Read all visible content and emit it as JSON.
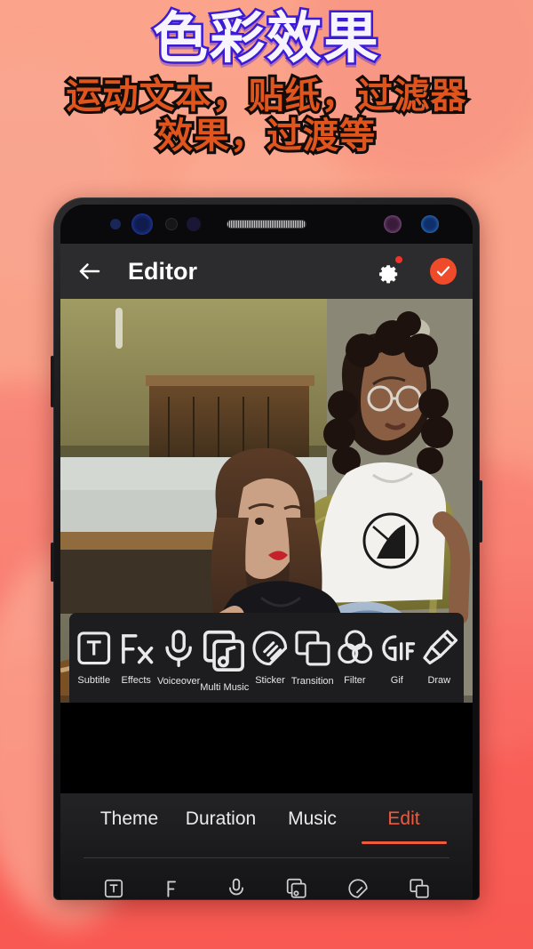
{
  "promo": {
    "title": "色彩效果",
    "subtitle_line1": "运动文本，贴纸，过滤器",
    "subtitle_line2": "效果，过渡等",
    "title_color": "#F7F4FB",
    "title_outline_color": "#3A1BD8",
    "subtitle_color": "#E0551E",
    "subtitle_outline_color": "#120C0A",
    "background_color": "#F96159"
  },
  "app": {
    "header": {
      "back_label": "back-arrow",
      "title": "Editor",
      "settings_label": "settings",
      "settings_badge": true,
      "confirm_label": "confirm",
      "accent_color": "#EF4A29"
    },
    "toolbar": {
      "items": [
        {
          "label": "Subtitle",
          "icon": "subtitle-icon"
        },
        {
          "label": "Effects",
          "icon": "effects-icon"
        },
        {
          "label": "Voiceover",
          "icon": "microphone-icon"
        },
        {
          "label": "Multi Music",
          "icon": "multi-music-icon"
        },
        {
          "label": "Sticker",
          "icon": "sticker-icon"
        },
        {
          "label": "Transition",
          "icon": "transition-icon"
        },
        {
          "label": "Filter",
          "icon": "filter-icon"
        },
        {
          "label": "Gif",
          "icon": "gif-icon"
        },
        {
          "label": "Draw",
          "icon": "draw-icon"
        }
      ]
    },
    "tabs": [
      {
        "label": "Theme",
        "active": false
      },
      {
        "label": "Duration",
        "active": false
      },
      {
        "label": "Music",
        "active": false
      },
      {
        "label": "Edit",
        "active": true
      }
    ],
    "tab_active_color": "#F05A3C"
  }
}
